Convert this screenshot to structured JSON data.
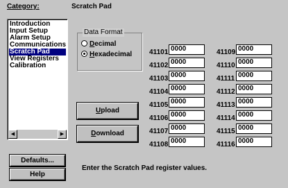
{
  "category": {
    "label": "Category:",
    "items": [
      {
        "label": "Introduction",
        "selected": false
      },
      {
        "label": "Input Setup",
        "selected": false
      },
      {
        "label": "Alarm Setup",
        "selected": false
      },
      {
        "label": "Communications",
        "selected": false
      },
      {
        "label": "Scratch Pad",
        "selected": true
      },
      {
        "label": "View Registers",
        "selected": false
      },
      {
        "label": "Calibration",
        "selected": false
      }
    ],
    "scroll_left_icon": "arrow-left-icon",
    "scroll_right_icon": "arrow-right-icon"
  },
  "panel": {
    "title": "Scratch Pad"
  },
  "data_format": {
    "title": "Data Format",
    "options": [
      {
        "mnemonic": "D",
        "rest": "ecimal",
        "checked": false
      },
      {
        "mnemonic": "H",
        "rest": "exadecimal",
        "checked": true
      }
    ]
  },
  "buttons": {
    "upload": {
      "mnemonic": "U",
      "rest": "pload"
    },
    "download": {
      "mnemonic": "D",
      "rest": "ownload"
    },
    "defaults": "Defaults...",
    "help": "Help"
  },
  "registers": {
    "left": [
      {
        "label": "41101",
        "value": "0000"
      },
      {
        "label": "41102",
        "value": "0000"
      },
      {
        "label": "41103",
        "value": "0000"
      },
      {
        "label": "41104",
        "value": "0000"
      },
      {
        "label": "41105",
        "value": "0000"
      },
      {
        "label": "41106",
        "value": "0000"
      },
      {
        "label": "41107",
        "value": "0000"
      },
      {
        "label": "41108",
        "value": "0000"
      }
    ],
    "right": [
      {
        "label": "41109",
        "value": "0000"
      },
      {
        "label": "41110",
        "value": "0000"
      },
      {
        "label": "41111",
        "value": "0000"
      },
      {
        "label": "41112",
        "value": "0000"
      },
      {
        "label": "41113",
        "value": "0000"
      },
      {
        "label": "41114",
        "value": "0000"
      },
      {
        "label": "41115",
        "value": "0000"
      },
      {
        "label": "41116",
        "value": "0000"
      }
    ]
  },
  "status_text": "Enter the Scratch Pad register values."
}
